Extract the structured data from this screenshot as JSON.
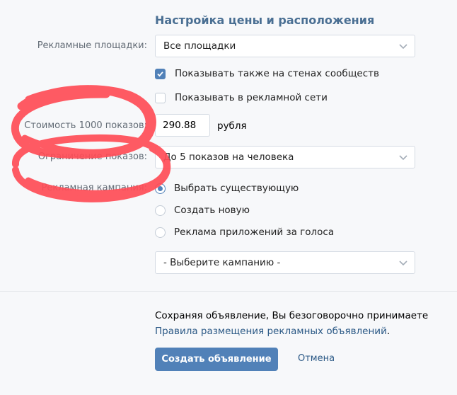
{
  "section_title": "Настройка цены и расположения",
  "platforms": {
    "label": "Рекламные площадки:",
    "value": "Все площадки",
    "options": [
      {
        "label": "Показывать также на стенах сообществ",
        "checked": true
      },
      {
        "label": "Показывать в рекламной сети",
        "checked": false
      }
    ]
  },
  "cost": {
    "label": "Стоимость 1000 показов:",
    "value": "290.88",
    "unit": "рубля"
  },
  "limit": {
    "label": "Ограничение показов:",
    "value": "До 5 показов на человека"
  },
  "campaign": {
    "label": "Рекламная кампания:",
    "options": [
      {
        "label": "Выбрать существующую",
        "selected": true
      },
      {
        "label": "Создать новую",
        "selected": false
      },
      {
        "label": "Реклама приложений за голоса",
        "selected": false
      }
    ],
    "select_value": "- Выберите кампанию -"
  },
  "footer": {
    "note": "Сохраняя объявление, Вы безоговорочно принимаете",
    "rules_link": "Правила размещения рекламных объявлений",
    "rules_suffix": ".",
    "create_button": "Создать объявление",
    "cancel_link": "Отмена"
  },
  "colors": {
    "title": "#4a6f93",
    "accent": "#5181b8",
    "link": "#2a5885",
    "scribble": "#ff4d57"
  }
}
